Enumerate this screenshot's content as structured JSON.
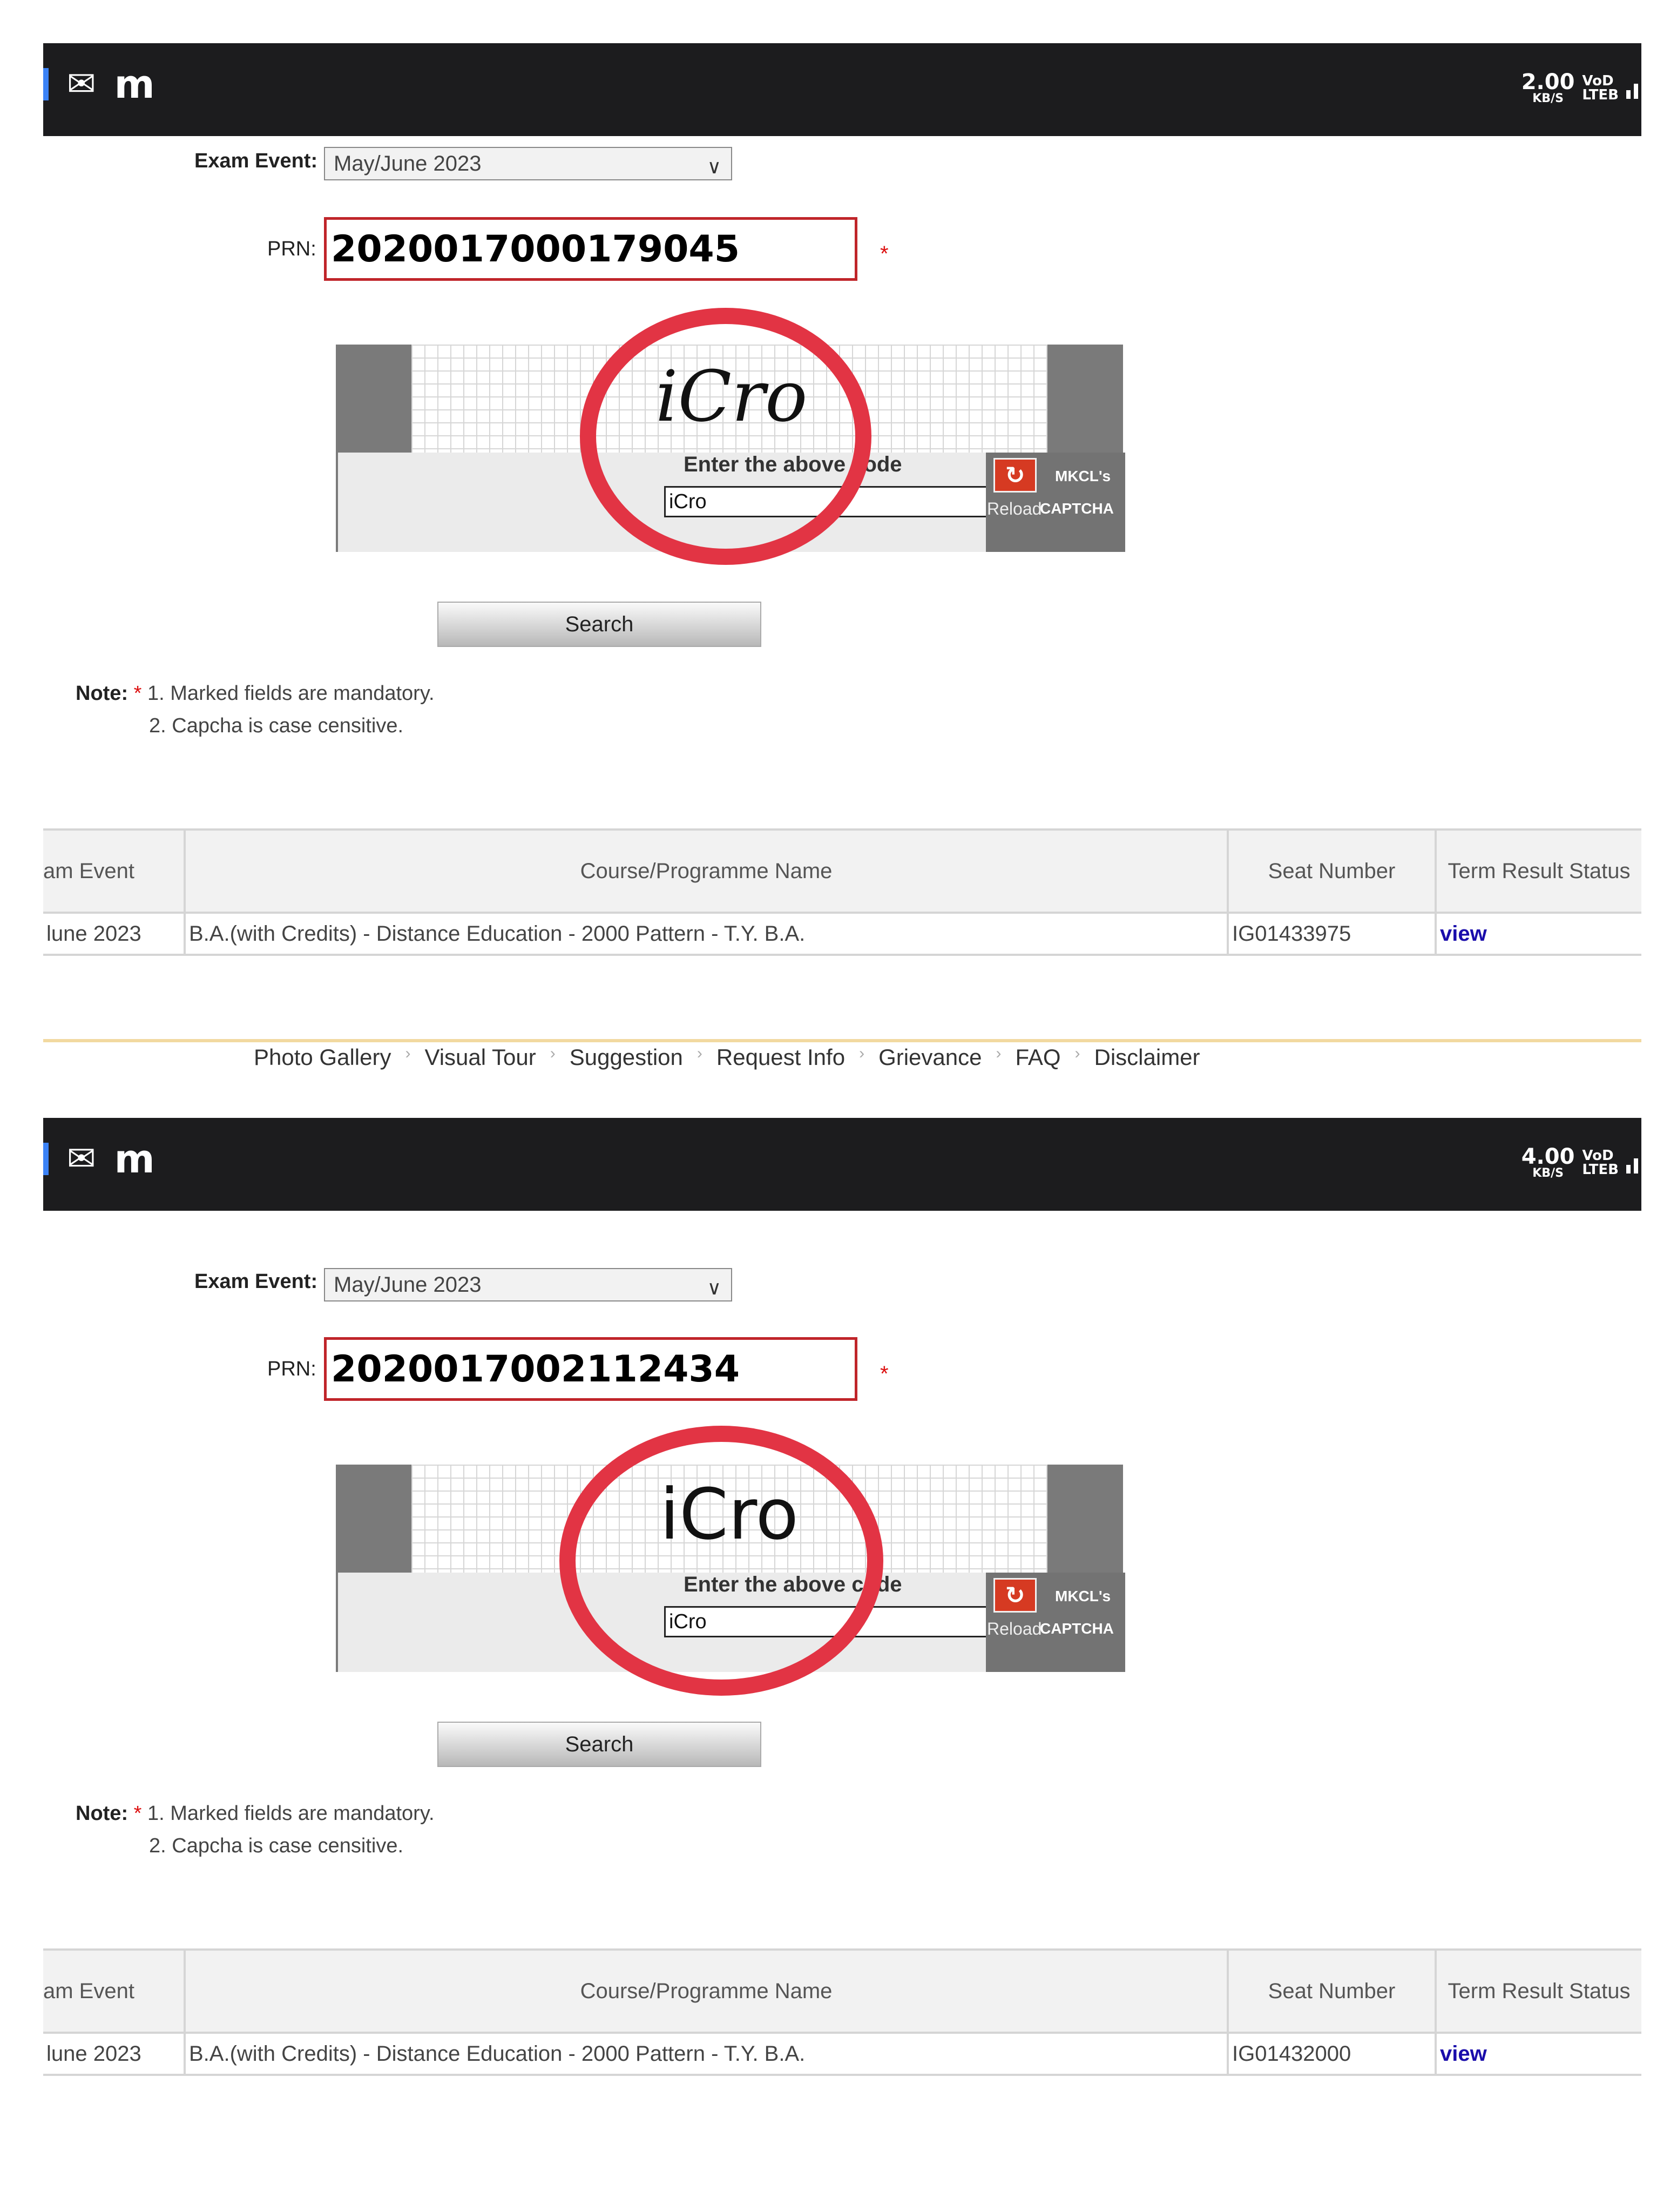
{
  "panels": [
    {
      "status_bar": {
        "icons": [
          "gmail-icon",
          "m-app-icon"
        ],
        "speed": "2.00",
        "speed_unit": "KB/S",
        "network_top": "VoD",
        "network_bottom": "LTEB"
      },
      "form": {
        "exam_event_label": "Exam Event:",
        "exam_event_value": "May/June 2023",
        "prn_label": "PRN:",
        "prn_value": "2020017000179045",
        "required_mark": "*",
        "captcha_image_text": "iCro",
        "captcha_prompt": "Enter the above code",
        "captcha_input_value": "iCro",
        "reload_label": "Reload",
        "brand_top": "MKCL's",
        "brand_bottom": "CAPTCHA",
        "search_label": "Search"
      },
      "note": {
        "label": "Note:",
        "star": "*",
        "line1": "1. Marked fields are mandatory.",
        "line2": "2. Capcha is case censitive."
      },
      "table": {
        "headers": [
          "am Event",
          "Course/Programme Name",
          "Seat Number",
          "Term Result Status"
        ],
        "row": [
          "lune 2023",
          "B.A.(with Credits) - Distance Education - 2000 Pattern - T.Y. B.A.",
          "IG01433975",
          "view"
        ]
      },
      "footer_links": [
        "Photo Gallery",
        "Visual Tour",
        "Suggestion",
        "Request Info",
        "Grievance",
        "FAQ",
        "Disclaimer"
      ]
    },
    {
      "status_bar": {
        "icons": [
          "gmail-icon",
          "m-app-icon"
        ],
        "speed": "4.00",
        "speed_unit": "KB/S",
        "network_top": "VoD",
        "network_bottom": "LTEB"
      },
      "form": {
        "exam_event_label": "Exam Event:",
        "exam_event_value": "May/June 2023",
        "prn_label": "PRN:",
        "prn_value": "2020017002112434",
        "required_mark": "*",
        "captcha_image_text": "iCro",
        "captcha_prompt": "Enter the above code",
        "captcha_input_value": "iCro",
        "reload_label": "Reload",
        "brand_top": "MKCL's",
        "brand_bottom": "CAPTCHA",
        "search_label": "Search"
      },
      "note": {
        "label": "Note:",
        "star": "*",
        "line1": "1. Marked fields are mandatory.",
        "line2": "2. Capcha is case censitive."
      },
      "table": {
        "headers": [
          "am Event",
          "Course/Programme Name",
          "Seat Number",
          "Term Result Status"
        ],
        "row": [
          "lune 2023",
          "B.A.(with Credits) - Distance Education - 2000 Pattern - T.Y. B.A.",
          "IG01432000",
          "view"
        ]
      }
    }
  ],
  "colors": {
    "status_bar": "#1c1c1e",
    "prn_border": "#c0252a",
    "highlight_circle": "#e23444",
    "view_link": "#1a0dab",
    "reload_button": "#d63a22"
  }
}
